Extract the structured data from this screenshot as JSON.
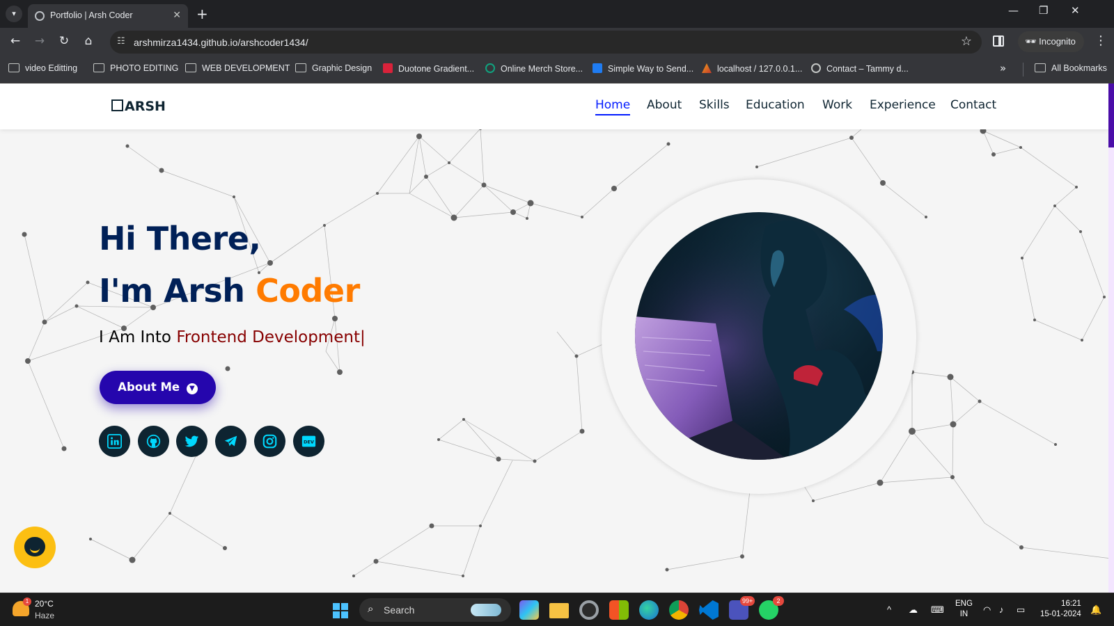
{
  "browser": {
    "tab_title": "Portfolio | Arsh Coder",
    "tab_close": "✕",
    "new_tab": "+",
    "url": "arshmirza1434.github.io/arshcoder1434/",
    "incognito_label": "Incognito",
    "window_controls": {
      "minimize": "—",
      "restore": "❐",
      "close": "✕"
    }
  },
  "bookmarks": {
    "items": [
      {
        "label": "video Editting",
        "icon": "folder-icon"
      },
      {
        "label": "PHOTO EDITING",
        "icon": "folder-icon"
      },
      {
        "label": "WEB DEVELOPMENT",
        "icon": "folder-icon"
      },
      {
        "label": "Graphic Design",
        "icon": "folder-icon"
      },
      {
        "label": "Duotone Gradient...",
        "icon": "duotone-icon"
      },
      {
        "label": "Online Merch Store...",
        "icon": "chatgpt-icon"
      },
      {
        "label": "Simple Way to Send...",
        "icon": "w-icon"
      },
      {
        "label": "localhost / 127.0.0.1...",
        "icon": "phpmyadmin-icon"
      },
      {
        "label": "Contact – Tammy d...",
        "icon": "globe-icon"
      }
    ],
    "overflow": "»",
    "all_bookmarks": "All Bookmarks"
  },
  "site": {
    "logo": "ARSH",
    "nav": [
      "Home",
      "About",
      "Skills",
      "Education",
      "Work",
      "Experience",
      "Contact"
    ],
    "active_nav": "Home",
    "hero": {
      "line1": "Hi There,",
      "line2_prefix": "I'm Arsh ",
      "line2_accent": "Coder",
      "tagline_prefix": "I Am Into ",
      "tagline_typed": "Frontend Development",
      "cursor": "|",
      "button_label": "About Me",
      "button_icon": "arrow-down-circle-icon"
    },
    "socials": [
      "linkedin-icon",
      "github-icon",
      "twitter-icon",
      "telegram-icon",
      "instagram-icon",
      "dev-icon"
    ],
    "dev_icon_text": "DEV"
  },
  "colors": {
    "heading": "#002057",
    "accent": "#ff7b00",
    "typed": "#870000",
    "button": "#2506ad",
    "nav_active": "#011aff",
    "social_icon": "#00d9ff",
    "chat_button": "#fcbf12"
  },
  "taskbar": {
    "temperature": "20°C",
    "condition": "Haze",
    "weather_badge": "1",
    "search_label": "Search",
    "teams_badge": "99+",
    "whatsapp_badge": "2",
    "language": "ENG",
    "region": "IN",
    "time": "16:21",
    "date": "15-01-2024"
  }
}
